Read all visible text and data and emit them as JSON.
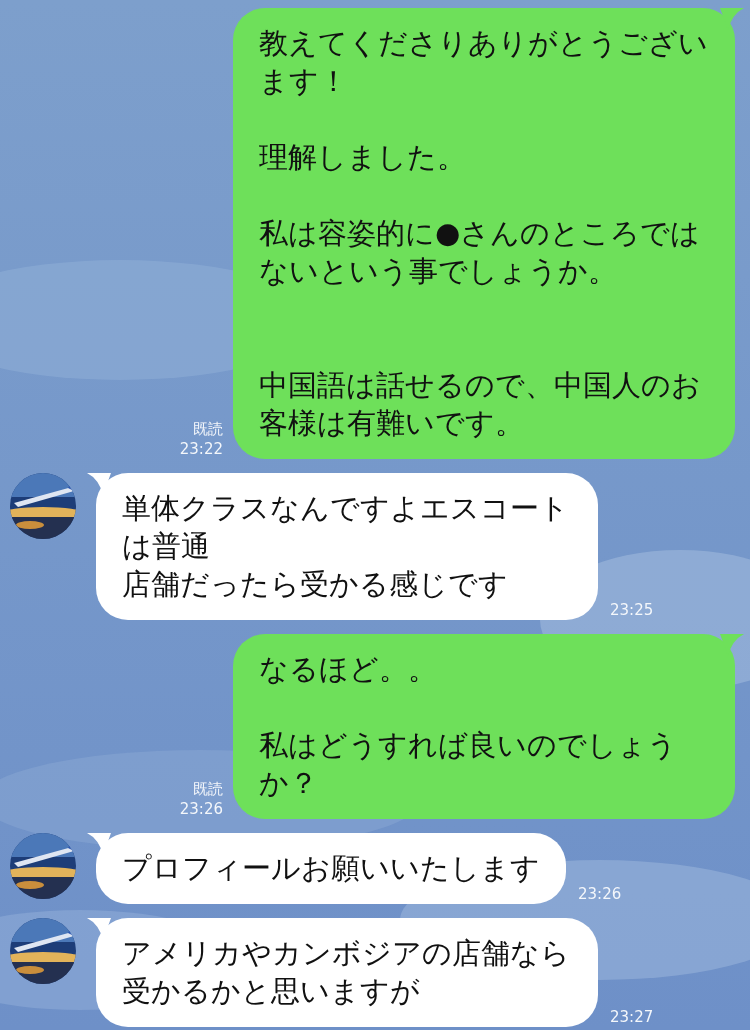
{
  "messages": [
    {
      "kind": "outgoing",
      "paragraphs": [
        {
          "text": "教えてくださりありがとうございます！",
          "kind": "first"
        },
        {
          "text": "理解しました。",
          "kind": "spaced"
        },
        {
          "text": "私は容姿的に●さんのところではないという事でしょうか。",
          "kind": "spaced"
        },
        {
          "text": "中国語は話せるので、中国人のお客様は有難いです。",
          "kind": "wide"
        }
      ],
      "read_label": "既読",
      "time": "23:22"
    },
    {
      "kind": "incoming",
      "paragraphs": [
        {
          "text": "単体クラスなんですよエスコートは普通",
          "kind": "first"
        },
        {
          "text": "店舗だったら受かる感じです",
          "kind": "first"
        }
      ],
      "time": "23:25"
    },
    {
      "kind": "outgoing",
      "paragraphs": [
        {
          "text": "なるほど。。",
          "kind": "first"
        },
        {
          "text": "私はどうすれば良いのでしょうか？",
          "kind": "spaced"
        }
      ],
      "read_label": "既読",
      "time": "23:26"
    },
    {
      "kind": "incoming",
      "paragraphs": [
        {
          "text": "プロフィールお願いいたします",
          "kind": "first"
        }
      ],
      "time": "23:26"
    },
    {
      "kind": "incoming",
      "paragraphs": [
        {
          "text": "アメリカやカンボジアの店舗なら受かるかと思いますが",
          "kind": "first"
        }
      ],
      "time": "23:27"
    }
  ]
}
